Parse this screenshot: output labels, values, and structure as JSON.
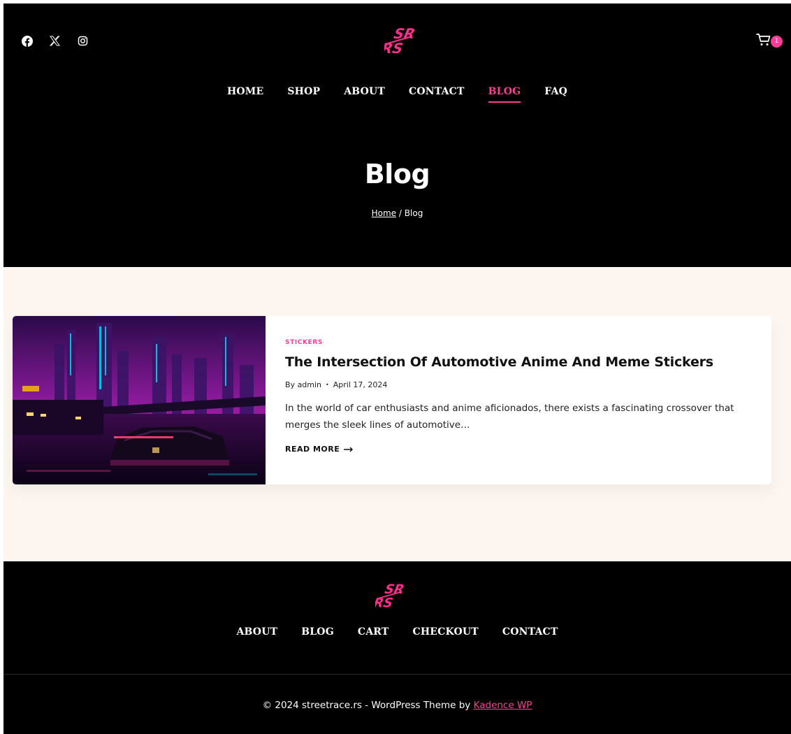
{
  "header": {
    "social_icons": [
      "facebook-icon",
      "x-twitter-icon",
      "instagram-icon"
    ],
    "logo_alt": "SR RS",
    "cart_count": "1",
    "nav": [
      {
        "label": "HOME",
        "active": false
      },
      {
        "label": "SHOP",
        "active": false
      },
      {
        "label": "ABOUT",
        "active": false
      },
      {
        "label": "CONTACT",
        "active": false
      },
      {
        "label": "BLOG",
        "active": true
      },
      {
        "label": "FAQ",
        "active": false
      }
    ],
    "page_title": "Blog",
    "breadcrumb": {
      "home": "Home",
      "separator": "/",
      "current": "Blog"
    }
  },
  "post": {
    "category": "STICKERS",
    "title": "The Intersection Of Automotive Anime And Meme Stickers",
    "author_prefix": "By",
    "author": "admin",
    "bullet": "•",
    "date": "April 17, 2024",
    "excerpt": "In the world of car enthusiasts and anime aficionados, there exists a fascinating crossover that merges the sleek lines of automotive…",
    "read_more": "READ MORE",
    "read_more_icon": "arrow-right-icon"
  },
  "footer": {
    "nav": [
      "ABOUT",
      "BLOG",
      "CART",
      "CHECKOUT",
      "CONTACT"
    ],
    "copyright_prefix": "© 2024 streetrace.rs - WordPress Theme by",
    "copyright_link": "Kadence WP"
  },
  "colors": {
    "accent": "#ff3d96",
    "header_bg": "#000000",
    "content_bg": "#fdf6f0",
    "card_bg": "#ffffff"
  }
}
